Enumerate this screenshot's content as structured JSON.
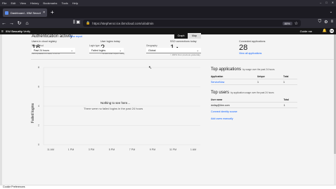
{
  "menubar": {
    "items": [
      "File",
      "Edit",
      "View",
      "History",
      "Bookmarks",
      "Tools",
      "Help"
    ]
  },
  "browser": {
    "tab_title": "Dashboard - IBM Security Ve",
    "url": "https://stephencr.ice.ibmcloud.com/ui/admin",
    "zoom": "80%"
  },
  "app": {
    "brand_prefix": "IBM",
    "brand_name": "Security",
    "brand_suffix": "Verify",
    "guide": "Guide me",
    "avatar": "SD"
  },
  "stats": [
    {
      "label": "Users in cloud registry",
      "value": "16",
      "sub": "Last updated on Wed, 5:53 1s",
      "link": ""
    },
    {
      "label": "User logins today",
      "value": "2",
      "sub": "↑ Sched user report today",
      "link": ""
    },
    {
      "label": "SSO connections today",
      "value": "1",
      "sub": "↑ 100% from previous yesterday",
      "link": ""
    },
    {
      "label": "Connected applications",
      "value": "28",
      "sub": "",
      "link": "View all applications"
    }
  ],
  "activity": {
    "title": "Authentication activity",
    "export": "View report",
    "toggle_graph": "Graph",
    "toggle_map": "Map",
    "filters": [
      {
        "label": "Time period",
        "value": "Past 24 hours"
      },
      {
        "label": "Login type",
        "value": "Failed logins"
      },
      {
        "label": "Geography",
        "value": "Global"
      }
    ],
    "no_data_title": "Nothing to see here...",
    "no_data_sub": "There were no failed logins in the past 24 hours"
  },
  "chart_data": {
    "type": "bar",
    "ylabel": "Failed logins",
    "yticks": [
      "8",
      "6",
      "4",
      "2",
      "0"
    ],
    "ylim": [
      0,
      8
    ],
    "xticks": [
      "11 AM",
      "1 PM",
      "3 PM",
      "5 PM",
      "7 PM",
      "9 PM",
      "11 PM",
      "1 AM"
    ],
    "values": []
  },
  "top_apps": {
    "title": "Top applications",
    "subtitle": "by usage over the past 24 hours",
    "headers": [
      "Application",
      "Unique",
      "Total"
    ],
    "rows": [
      [
        "ServiceNow",
        "1",
        "1"
      ]
    ]
  },
  "top_users": {
    "title": "Top users",
    "subtitle": "by application usage over the past 24 hours",
    "headers": [
      "User name",
      "Total"
    ],
    "rows": [
      [
        "dollay@ibm.com",
        "1"
      ]
    ],
    "link1": "Connect identity source",
    "link2": "Add users manually"
  },
  "status": "Cookie Preferences"
}
